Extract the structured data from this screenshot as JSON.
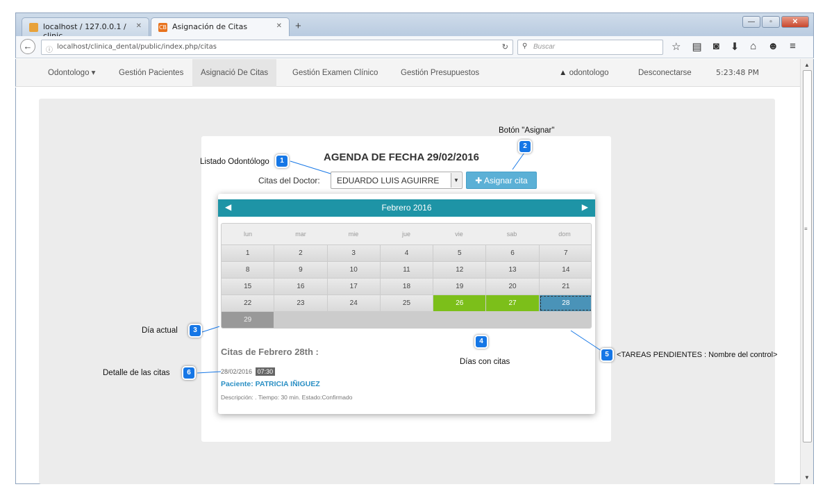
{
  "browser": {
    "tabs": [
      {
        "label": "localhost / 127.0.0.1 / clinic..."
      },
      {
        "label": "Asignación de Citas",
        "favicon": "CB"
      }
    ],
    "new_tab": "+",
    "url": "localhost/clinica_dental/public/index.php/citas",
    "search_placeholder": "Buscar",
    "window_buttons": {
      "minimize": "—",
      "maximize": "▫",
      "close": "✕"
    }
  },
  "appnav": {
    "items": [
      {
        "label": "Odontologo ▾"
      },
      {
        "label": "Gestión Pacientes"
      },
      {
        "label": "Asignació De Citas"
      },
      {
        "label": "Gestión Examen Clínico"
      },
      {
        "label": "Gestión Presupuestos"
      },
      {
        "label": "odontologo"
      },
      {
        "label": "Desconectarse"
      },
      {
        "label": "5:23:48 PM"
      }
    ]
  },
  "agenda": {
    "title": "AGENDA DE FECHA 29/02/2016",
    "doctor_label": "Citas del Doctor:",
    "doctor_selected": "EDUARDO LUIS AGUIRRE",
    "assign_button": "Asignar cita"
  },
  "calendar": {
    "month_label": "Febrero 2016",
    "days_of_week": [
      "lun",
      "mar",
      "mie",
      "jue",
      "vie",
      "sab",
      "dom"
    ],
    "weeks": [
      [
        "1",
        "2",
        "3",
        "4",
        "5",
        "6",
        "7"
      ],
      [
        "8",
        "9",
        "10",
        "11",
        "12",
        "13",
        "14"
      ],
      [
        "15",
        "16",
        "17",
        "18",
        "19",
        "20",
        "21"
      ],
      [
        "22",
        "23",
        "24",
        "25",
        "26",
        "27",
        "28"
      ]
    ],
    "last_week_day": "29",
    "days_with_citas": [
      "26",
      "27"
    ],
    "selected_day": "28",
    "today": "29",
    "colors": {
      "header": "#1e94a6",
      "cita": "#7cbf1a",
      "selected": "#4a93b8"
    }
  },
  "citas": {
    "heading": "Citas de Febrero 28th :",
    "date": "28/02/2016",
    "time": "07:30",
    "patient": "Paciente: PATRICIA IÑIGUEZ",
    "description": "Descripción: . Tiempo: 30 min. Estado:Confirmado"
  },
  "annotations": [
    {
      "number": "1",
      "label": "Listado Odontólogo"
    },
    {
      "number": "2",
      "label": "Botón \"Asignar\""
    },
    {
      "number": "3",
      "label": "Día actual"
    },
    {
      "number": "4",
      "label": "Días con citas"
    },
    {
      "number": "5",
      "label": "<TAREAS PENDIENTES : Nombre del control>"
    },
    {
      "number": "6",
      "label": "Detalle de las citas"
    }
  ]
}
